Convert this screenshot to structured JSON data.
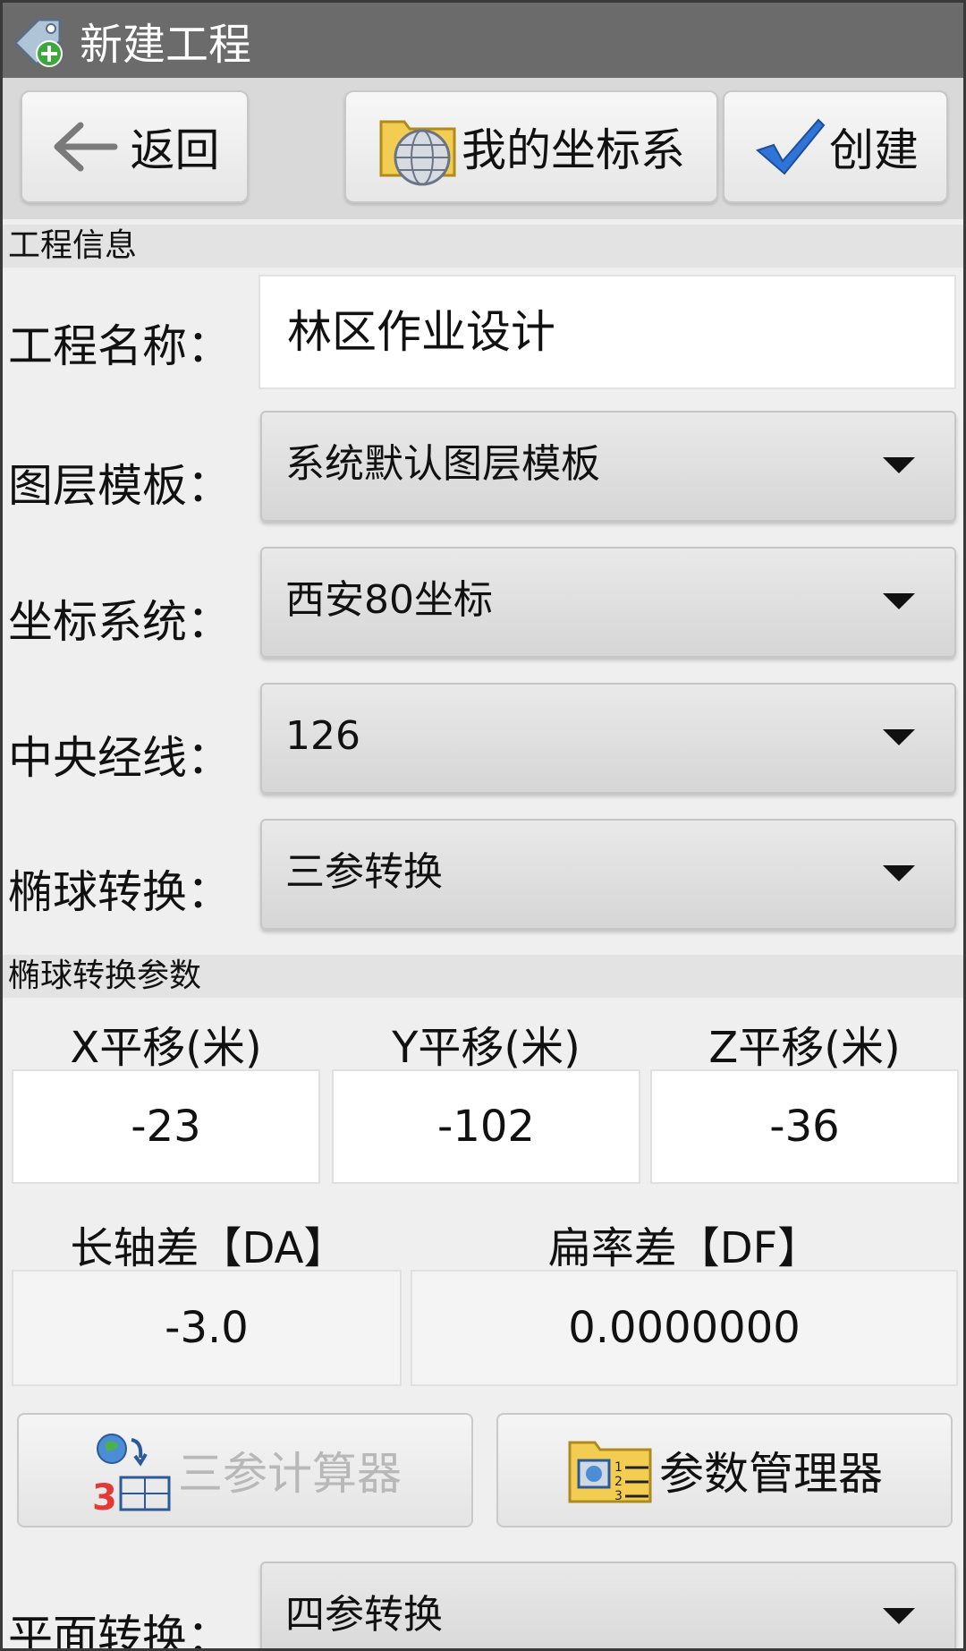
{
  "titlebar": {
    "title": "新建工程",
    "icon": "tag-add-icon"
  },
  "toolbar": {
    "back_label": "返回",
    "coord_label": "我的坐标系",
    "create_label": "创建"
  },
  "project_info": {
    "header": "工程信息",
    "name_label": "工程名称：",
    "name_value": "林区作业设计",
    "layer_label": "图层模板：",
    "layer_value": "系统默认图层模板",
    "coord_label": "坐标系统：",
    "coord_value": "西安80坐标",
    "meridian_label": "中央经线：",
    "meridian_value": "126",
    "ellipsoid_label": "椭球转换：",
    "ellipsoid_value": "三参转换"
  },
  "ellipsoid_params": {
    "header": "椭球转换参数",
    "x_label": "X平移(米)",
    "y_label": "Y平移(米)",
    "z_label": "Z平移(米)",
    "x_value": "-23",
    "y_value": "-102",
    "z_value": "-36",
    "da_label": "长轴差【DA】",
    "df_label": "扁率差【DF】",
    "da_value": "-3.0",
    "df_value": "0.0000000",
    "calc_label": "三参计算器",
    "manager_label": "参数管理器"
  },
  "plane": {
    "label": "平面转换：",
    "value": "四参转换"
  }
}
